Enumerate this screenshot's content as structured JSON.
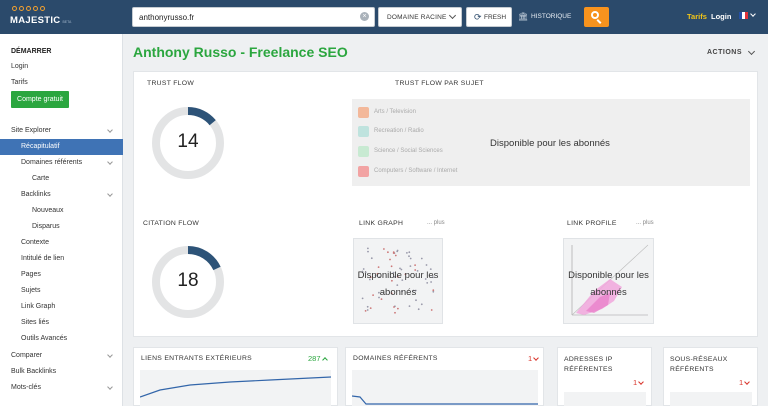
{
  "header": {
    "logo_text": "MAJESTIC",
    "logo_sub": "BETA",
    "search_value": "anthonyrusso.fr",
    "scope_label": "DOMAINE RACINE",
    "fresh_label": "FRESH",
    "historic_label": "HISTORIQUE",
    "tarifs_label": "Tarifs",
    "login_label": "Login",
    "accent": "#f7931e",
    "bar_color": "#2b4a6b"
  },
  "sidebar": {
    "items": [
      {
        "label": "DÉMARRER"
      },
      {
        "label": "Login"
      },
      {
        "label": "Tarifs"
      },
      {
        "label": "Compte gratuit"
      },
      {
        "label": "Site Explorer"
      },
      {
        "label": "Récapitulatif"
      },
      {
        "label": "Domaines référents"
      },
      {
        "label": "Carte"
      },
      {
        "label": "Backlinks"
      },
      {
        "label": "Nouveaux"
      },
      {
        "label": "Disparus"
      },
      {
        "label": "Contexte"
      },
      {
        "label": "Intitulé de lien"
      },
      {
        "label": "Pages"
      },
      {
        "label": "Sujets"
      },
      {
        "label": "Link Graph"
      },
      {
        "label": "Sites liés"
      },
      {
        "label": "Outils Avancés"
      },
      {
        "label": "Comparer"
      },
      {
        "label": "Bulk Backlinks"
      },
      {
        "label": "Mots-clés"
      }
    ]
  },
  "main": {
    "title": "Anthony Russo - Freelance SEO",
    "actions_label": "ACTIONS",
    "trust_flow": {
      "title": "TRUST FLOW",
      "value": "14",
      "fraction": 0.14
    },
    "citation_flow": {
      "title": "CITATION FLOW",
      "value": "18",
      "fraction": 0.18
    },
    "topical": {
      "title": "TRUST FLOW PAR SUJET",
      "topics": [
        {
          "label": "Arts / Television",
          "color": "#f3b89a"
        },
        {
          "label": "Recreation / Radio",
          "color": "#bfe3de"
        },
        {
          "label": "Science / Social Sciences",
          "color": "#c8ead2"
        },
        {
          "label": "Computers / Software / Internet",
          "color": "#f2a3a3"
        }
      ],
      "locked_text": "Disponible pour les abonnés"
    },
    "link_graph": {
      "title": "LINK GRAPH",
      "plus": "... plus",
      "locked_text": "Disponible pour les abonnés"
    },
    "link_profile": {
      "title": "LINK PROFILE",
      "plus": "... plus",
      "locked_text": "Disponible pour les abonnés"
    },
    "stats": [
      {
        "title": "LIENS ENTRANTS EXTÉRIEURS",
        "count": "287",
        "trend": "up",
        "color": "#2ba63f"
      },
      {
        "title": "DOMAINES RÉFÉRENTS",
        "count": "1",
        "trend": "down",
        "color": "#d9342b"
      },
      {
        "title": "ADRESSES IP RÉFÉRENTES",
        "count": "1",
        "trend": "down",
        "color": "#d9342b"
      },
      {
        "title": "SOUS-RÉSEAUX RÉFÉRENTS",
        "count": "1",
        "trend": "down",
        "color": "#d9342b"
      }
    ]
  }
}
